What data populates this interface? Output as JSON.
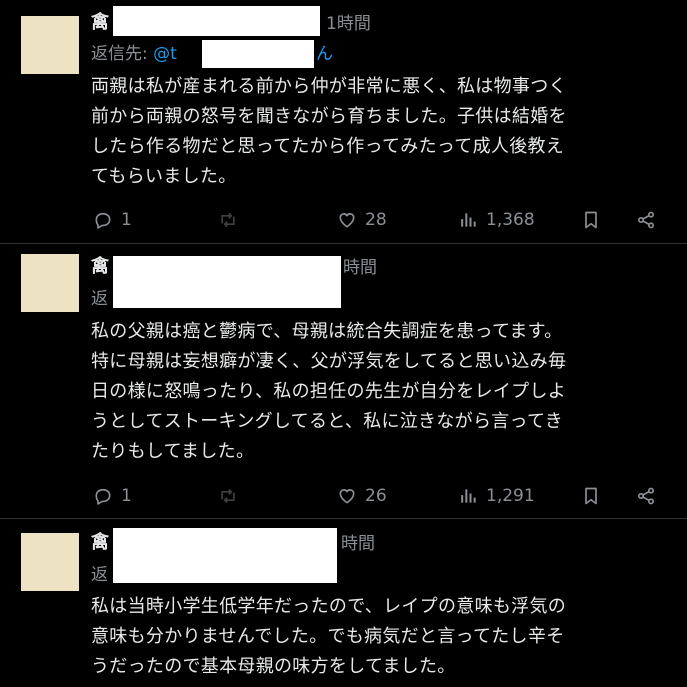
{
  "theme": {
    "background": "#000000",
    "text": "#e7e9ea",
    "muted": "#8b9096",
    "link": "#1d9bf0",
    "avatar": "#ede3c4",
    "redaction": "#ffffff"
  },
  "tweets": [
    {
      "name_visible": "禽",
      "time": "1時間",
      "reply_prefix": "返信先: ",
      "reply_handle_start": "@t",
      "reply_handle_end": "ん",
      "lines": [
        "両親は私が産まれる前から仲が非常に悪く、私は物事つく",
        "前から両親の怒号を聞きながら育ちました。子供は結婚を",
        "したら作る物だと思ってたから作ってみたって成人後教え",
        "てもらいました。"
      ],
      "replies": "1",
      "likes": "28",
      "views": "1,368"
    },
    {
      "name_visible": "禽",
      "time": "時間",
      "reply_prefix": "返",
      "lines": [
        "私の父親は癌と鬱病で、母親は統合失調症を患ってます。",
        "特に母親は妄想癖が凄く、父が浮気をしてると思い込み毎",
        "日の様に怒鳴ったり、私の担任の先生が自分をレイプしよ",
        "うとしてストーキングしてると、私に泣きながら言ってき",
        "たりもしてました。"
      ],
      "replies": "1",
      "likes": "26",
      "views": "1,291"
    },
    {
      "name_visible": "禽",
      "time": "時間",
      "reply_prefix": "返",
      "lines": [
        "私は当時小学生低学年だったので、レイプの意味も浮気の",
        "意味も分かりませんでした。でも病気だと言ってたし辛そ",
        "うだったので基本母親の味方をしてました。"
      ]
    }
  ],
  "icons": {
    "reply": "reply-bubble-icon",
    "retweet": "retweet-icon",
    "like": "heart-icon",
    "views": "views-bar-chart-icon",
    "bookmark": "bookmark-icon",
    "share": "share-icon"
  }
}
